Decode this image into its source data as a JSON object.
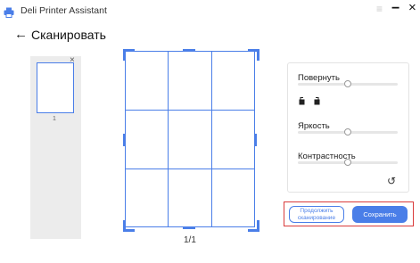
{
  "window": {
    "app_title": "Deli Printer Assistant",
    "menu_icon": "hamburger-menu-icon",
    "minimize_label": "−",
    "close_label": "×"
  },
  "header": {
    "back_icon": "back-arrow-icon",
    "back_label": "←",
    "title": "Сканировать"
  },
  "thumbnails": {
    "items": [
      {
        "number": "1"
      }
    ],
    "remove_label": "×"
  },
  "preview": {
    "page_counter": "1/1"
  },
  "settings": {
    "rotate_label": "Повернуть",
    "rotate_left_icon": "rotate-left-icon",
    "rotate_right_icon": "rotate-right-icon",
    "brightness_label": "Яркость",
    "contrast_label": "Контрастность",
    "reset_icon": "reset-icon",
    "reset_label": "↺"
  },
  "actions": {
    "continue_label": "Продолжить\nсканирование",
    "save_label": "Сохранить"
  },
  "colors": {
    "accent": "#4a7ee8",
    "highlight": "#d93b3b"
  }
}
